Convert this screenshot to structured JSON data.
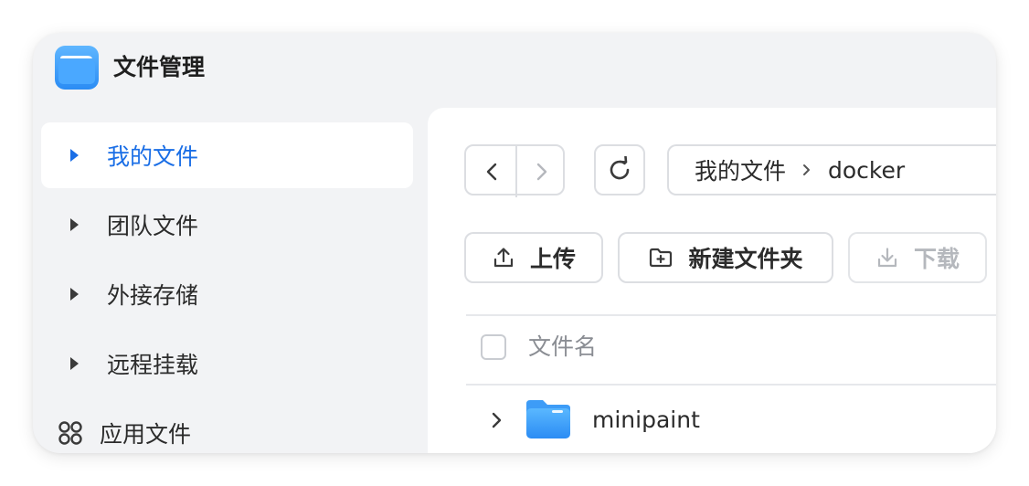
{
  "app": {
    "title": "文件管理",
    "icon": "folder-app-icon",
    "accent_color": "#1a6ee6"
  },
  "sidebar": {
    "items": [
      {
        "label": "我的文件",
        "icon": "triangle-right-icon",
        "active": true
      },
      {
        "label": "团队文件",
        "icon": "triangle-right-icon",
        "active": false
      },
      {
        "label": "外接存储",
        "icon": "triangle-right-icon",
        "active": false
      },
      {
        "label": "远程挂载",
        "icon": "triangle-right-icon",
        "active": false
      },
      {
        "label": "应用文件",
        "icon": "grid-icon",
        "active": false
      }
    ]
  },
  "toolbar": {
    "back_icon": "chevron-left-icon",
    "forward_icon": "chevron-right-icon",
    "refresh_icon": "refresh-icon",
    "breadcrumb": [
      "我的文件",
      "docker"
    ],
    "upload_label": "上传",
    "new_folder_label": "新建文件夹",
    "download_label": "下载"
  },
  "file_list": {
    "column_name": "文件名",
    "rows": [
      {
        "name": "minipaint",
        "type": "folder"
      }
    ]
  }
}
